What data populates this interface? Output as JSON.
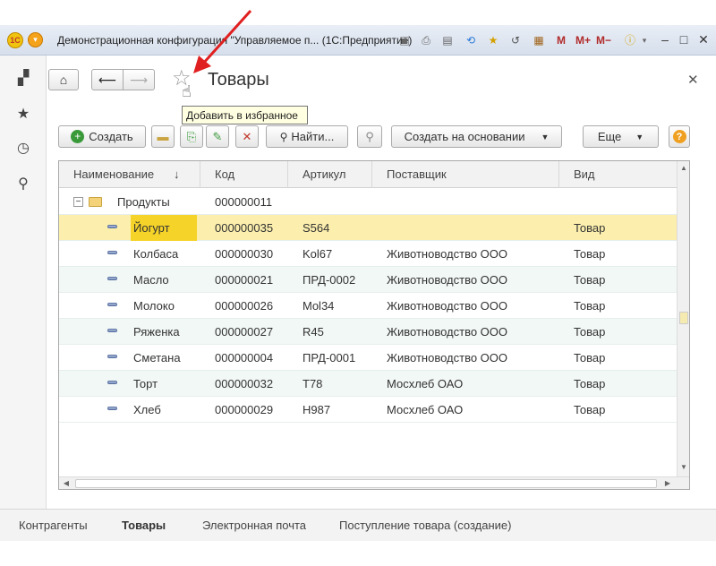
{
  "window": {
    "title": "Демонстрационная конфигурация \"Управляемое п...  (1С:Предприятие)",
    "logo_text": "1С",
    "toolbar_m": "M",
    "toolbar_mplus": "M+",
    "toolbar_mminus": "M−"
  },
  "form": {
    "title": "Товары",
    "tooltip": "Добавить в избранное"
  },
  "toolbar": {
    "create_label": "Создать",
    "find_label": "Найти...",
    "create_based_label": "Создать на основании",
    "more_label": "Еще",
    "help_label": "?"
  },
  "table": {
    "columns": {
      "name": "Наименование",
      "sort_indicator": "↓",
      "code": "Код",
      "article": "Артикул",
      "supplier": "Поставщик",
      "kind": "Вид"
    },
    "group": {
      "name": "Продукты",
      "code": "000000011"
    },
    "rows": [
      {
        "name": "Йогурт",
        "code": "000000035",
        "article": "S564",
        "supplier": "",
        "kind": "Товар"
      },
      {
        "name": "Колбаса",
        "code": "000000030",
        "article": "Kol67",
        "supplier": "Животноводство ООО",
        "kind": "Товар"
      },
      {
        "name": "Масло",
        "code": "000000021",
        "article": "ПРД-0002",
        "supplier": "Животноводство ООО",
        "kind": "Товар"
      },
      {
        "name": "Молоко",
        "code": "000000026",
        "article": "Mol34",
        "supplier": "Животноводство ООО",
        "kind": "Товар"
      },
      {
        "name": "Ряженка",
        "code": "000000027",
        "article": "R45",
        "supplier": "Животноводство ООО",
        "kind": "Товар"
      },
      {
        "name": "Сметана",
        "code": "000000004",
        "article": "ПРД-0001",
        "supplier": "Животноводство ООО",
        "kind": "Товар"
      },
      {
        "name": "Торт",
        "code": "000000032",
        "article": "T78",
        "supplier": "Мосхлеб ОАО",
        "kind": "Товар"
      },
      {
        "name": "Хлеб",
        "code": "000000029",
        "article": "H987",
        "supplier": "Мосхлеб ОАО",
        "kind": "Товар"
      }
    ]
  },
  "bottom_tabs": [
    {
      "label": "Контрагенты",
      "active": false
    },
    {
      "label": "Товары",
      "active": true
    },
    {
      "label": "Электронная почта",
      "active": false
    },
    {
      "label": "Поступление товара (создание)",
      "active": false
    }
  ],
  "colors": {
    "selected_row": "#fcefad",
    "selected_cell": "#f5d328",
    "alt_row": "#f2f8f6",
    "annotation_arrow": "#e02020"
  }
}
